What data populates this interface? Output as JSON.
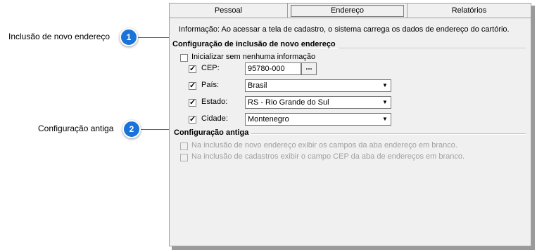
{
  "callouts": [
    {
      "number": "1",
      "label": "Inclusão de novo endereço"
    },
    {
      "number": "2",
      "label": "Configuração antiga"
    }
  ],
  "tabs": [
    {
      "label": "Pessoal",
      "active": false
    },
    {
      "label": "Endereço",
      "active": true
    },
    {
      "label": "Relatórios",
      "active": false
    }
  ],
  "info_text": "Informação: Ao acessar a tela de cadastro, o sistema carrega os dados de endereço do cartório.",
  "new_address": {
    "title": "Configuração de inclusão de novo endereço",
    "init_empty": {
      "label": "Inicializar sem nenhuma informação",
      "checked": false
    },
    "cep": {
      "label": "CEP:",
      "checked": true,
      "value": "95780-000",
      "button": "..."
    },
    "pais": {
      "label": "País:",
      "checked": true,
      "value": "Brasil"
    },
    "estado": {
      "label": "Estado:",
      "checked": true,
      "value": "RS - Rio Grande do Sul"
    },
    "cidade": {
      "label": "Cidade:",
      "checked": true,
      "value": "Montenegro"
    }
  },
  "old_config": {
    "title": "Configuração antiga",
    "option1": {
      "label": "Na inclusão de novo endereço exibir os campos da aba endereço em branco.",
      "checked": false
    },
    "option2": {
      "label": "Na inclusão de cadastros exibir o campo CEP da aba de endereços em branco.",
      "checked": false
    }
  },
  "colors": {
    "callout_blue": "#1a73d9",
    "panel_bg": "#f0f0f0"
  }
}
